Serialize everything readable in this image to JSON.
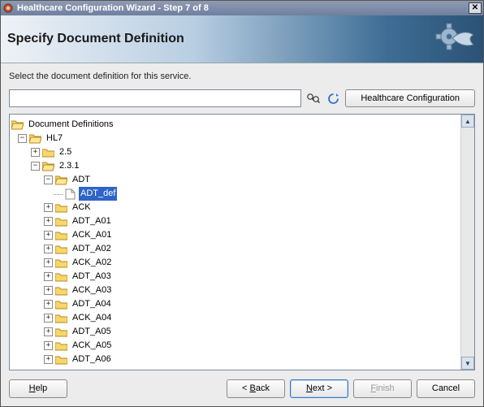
{
  "window": {
    "title": "Healthcare Configuration Wizard - Step 7 of 8"
  },
  "banner": {
    "heading": "Specify Document Definition"
  },
  "instruction": "Select the document definition for this service.",
  "search": {
    "value": ""
  },
  "buttons": {
    "healthcare_config": "Healthcare Configuration",
    "help": "Help",
    "back": "< Back",
    "next": "Next >",
    "finish": "Finish",
    "cancel": "Cancel"
  },
  "tree": {
    "root": "Document Definitions",
    "hl7": "HL7",
    "v25": "2.5",
    "v231": "2.3.1",
    "adt": "ADT",
    "adt_def": "ADT_def",
    "children": [
      "ACK",
      "ADT_A01",
      "ACK_A01",
      "ADT_A02",
      "ACK_A02",
      "ADT_A03",
      "ACK_A03",
      "ADT_A04",
      "ACK_A04",
      "ADT_A05",
      "ACK_A05",
      "ADT_A06"
    ]
  }
}
